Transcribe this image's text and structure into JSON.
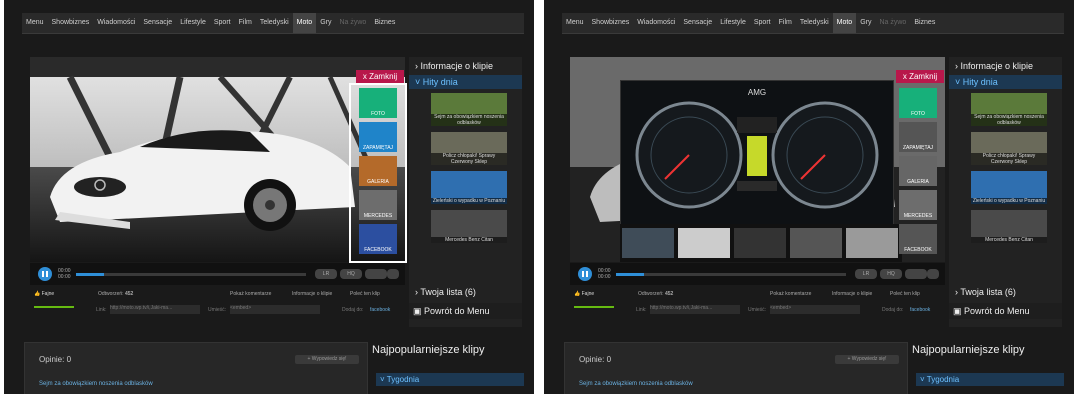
{
  "nav": [
    "Menu",
    "Showbiznes",
    "Wiadomości",
    "Sensacje",
    "Lifestyle",
    "Sport",
    "Film",
    "Teledyski",
    "Moto",
    "Gry",
    "Na żywo",
    "Biznes"
  ],
  "nav_active": "Moto",
  "close_label": "x Zamknij",
  "side": {
    "info_label": "Informacje o klipie",
    "hits_label": "Hity dnia",
    "thumbs": [
      "Sejm za obowiązkiem noszenia odblasków",
      "Policz chłopaki! Sprawy Czerwony Sklep",
      "Zieleński o wypadku w Poznaniu",
      "Mercedes Benz Citan"
    ]
  },
  "shares": [
    "FOTO",
    "ZAPAMIĘTAJ",
    "GALERIA",
    "MERCEDES",
    "FACEBOOK"
  ],
  "player": {
    "time_top": "00:00",
    "time_bottom": "00:00",
    "progress": 0.12,
    "btn_lr": "LR",
    "btn_hq": "HQ"
  },
  "meta": {
    "fajne": "Fajne",
    "views_label": "Odtworzeń:",
    "views": "452",
    "comments": "Pokaż komentarze",
    "info": "Informacje o klipie",
    "poke": "Poleć ten klip",
    "link_label": "Link:",
    "link_value": "http://moto.wp.tv/i,Jaki-ma...",
    "embed_label": "Umieść:",
    "embed_value": "<embed>",
    "dodaj": "Dodaj do:",
    "facebook": "facebook"
  },
  "twoja": "Twoja lista (6)",
  "powrot": "Powrót do Menu",
  "opinie": {
    "title": "Opinie: 0",
    "button": "+ Wypowiedz się!",
    "line": "Sejm za obowiązkiem noszenia odblasków"
  },
  "najpop": "Najpopularniejsze klipy",
  "tygodnia": "Tygodnia",
  "dash_brand": "AMG",
  "colors": {
    "accent": "#2f8fd8",
    "close": "#b8174b",
    "bg": "#1a1a1a"
  }
}
